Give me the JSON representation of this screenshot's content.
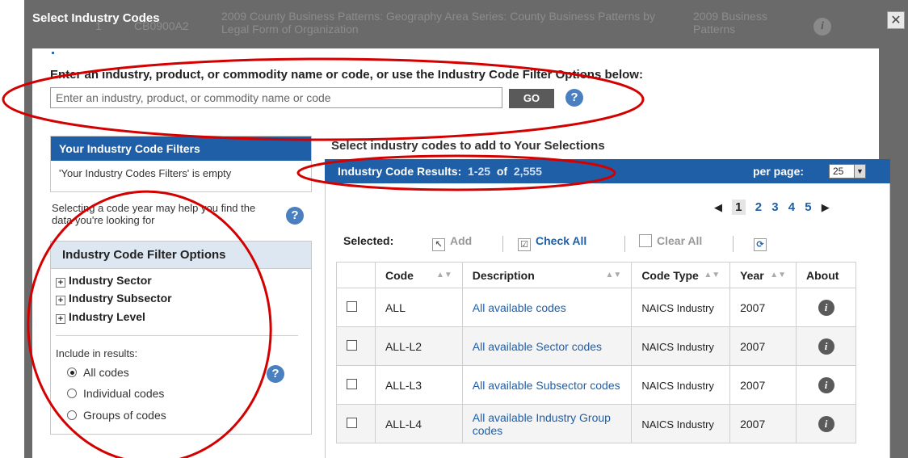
{
  "background": {
    "row_number": "1",
    "row_code": "CB0900A2",
    "row_title": "2009 County Business Patterns: Geography Area Series: County Business Patterns by Legal Form of Organization",
    "row_program": "2009 Business Patterns",
    "info_icon": "info-icon",
    "close_label": "✕"
  },
  "modal": {
    "title": "Select Industry Codes"
  },
  "search": {
    "instruction": "Enter an industry, product, or commodity name or code, or use the Industry Code Filter Options below:",
    "placeholder": "Enter an industry, product, or commodity name or code",
    "go_label": "GO",
    "help_label": "?"
  },
  "filters": {
    "title": "Your Industry Code Filters",
    "empty_text": "'Your Industry Codes Filters' is empty",
    "year_hint": "Selecting a code year may help you find the data you're looking for",
    "help_label": "?"
  },
  "options": {
    "title": "Industry Code Filter Options",
    "tree": [
      "Industry Sector",
      "Industry Subsector",
      "Industry Level"
    ],
    "include_label": "Include in results:",
    "radios": [
      {
        "label": "All codes",
        "checked": true
      },
      {
        "label": "Individual codes",
        "checked": false
      },
      {
        "label": "Groups of codes",
        "checked": false
      }
    ],
    "help_label": "?"
  },
  "results": {
    "instruction": "Select industry codes to add to Your Selections",
    "header_label": "Industry Code Results:",
    "range": "1-25",
    "of_label": "of",
    "total": "2,555",
    "per_page_label": "per page:",
    "per_page_value": "25",
    "pager": [
      "1",
      "2",
      "3",
      "4",
      "5"
    ],
    "selected_label": "Selected:",
    "add_label": "Add",
    "check_all_label": "Check All",
    "clear_all_label": "Clear All",
    "columns": [
      "Code",
      "Description",
      "Code Type",
      "Year",
      "About"
    ],
    "rows": [
      {
        "code": "ALL",
        "description": "All available codes",
        "code_type": "NAICS Industry",
        "year": "2007"
      },
      {
        "code": "ALL-L2",
        "description": "All available Sector codes",
        "code_type": "NAICS Industry",
        "year": "2007"
      },
      {
        "code": "ALL-L3",
        "description": "All available Subsector codes",
        "code_type": "NAICS Industry",
        "year": "2007"
      },
      {
        "code": "ALL-L4",
        "description": "All available Industry Group codes",
        "code_type": "NAICS Industry",
        "year": "2007"
      }
    ]
  },
  "colors": {
    "header_blue": "#1f5fa7",
    "link_blue": "#1f5fa7",
    "annotation_red": "#d40000",
    "go_button": "#5a5a5a"
  }
}
